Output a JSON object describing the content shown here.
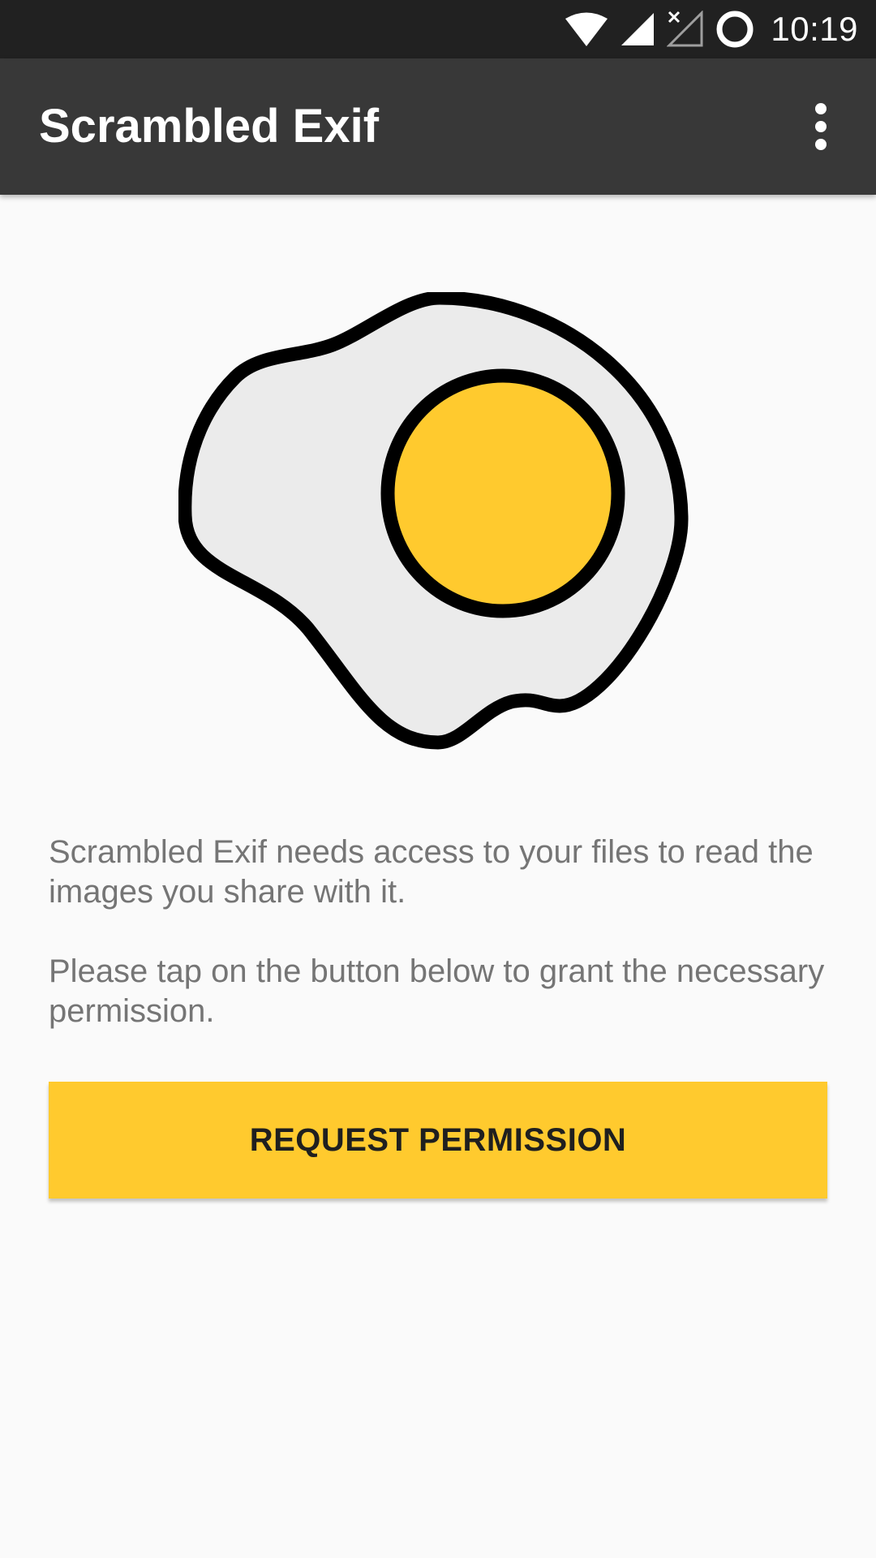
{
  "status_bar": {
    "time": "10:19",
    "icons": [
      "wifi-icon",
      "cell-signal-icon",
      "no-signal-icon",
      "battery-icon"
    ]
  },
  "app_bar": {
    "title": "Scrambled Exif",
    "menu_icon": "more-vert-icon"
  },
  "illustration": {
    "name": "fried-egg-icon",
    "yolk_color": "#ffca2e",
    "white_color": "#ebebeb"
  },
  "message": {
    "paragraph1": "Scrambled Exif needs access to your files to read the images you share with it.",
    "paragraph2": "Please tap on the button below to grant the necessary permission."
  },
  "actions": {
    "request_label": "REQUEST PERMISSION"
  },
  "colors": {
    "accent": "#ffca2e",
    "app_bar": "#383838",
    "status_bar": "#212121"
  }
}
